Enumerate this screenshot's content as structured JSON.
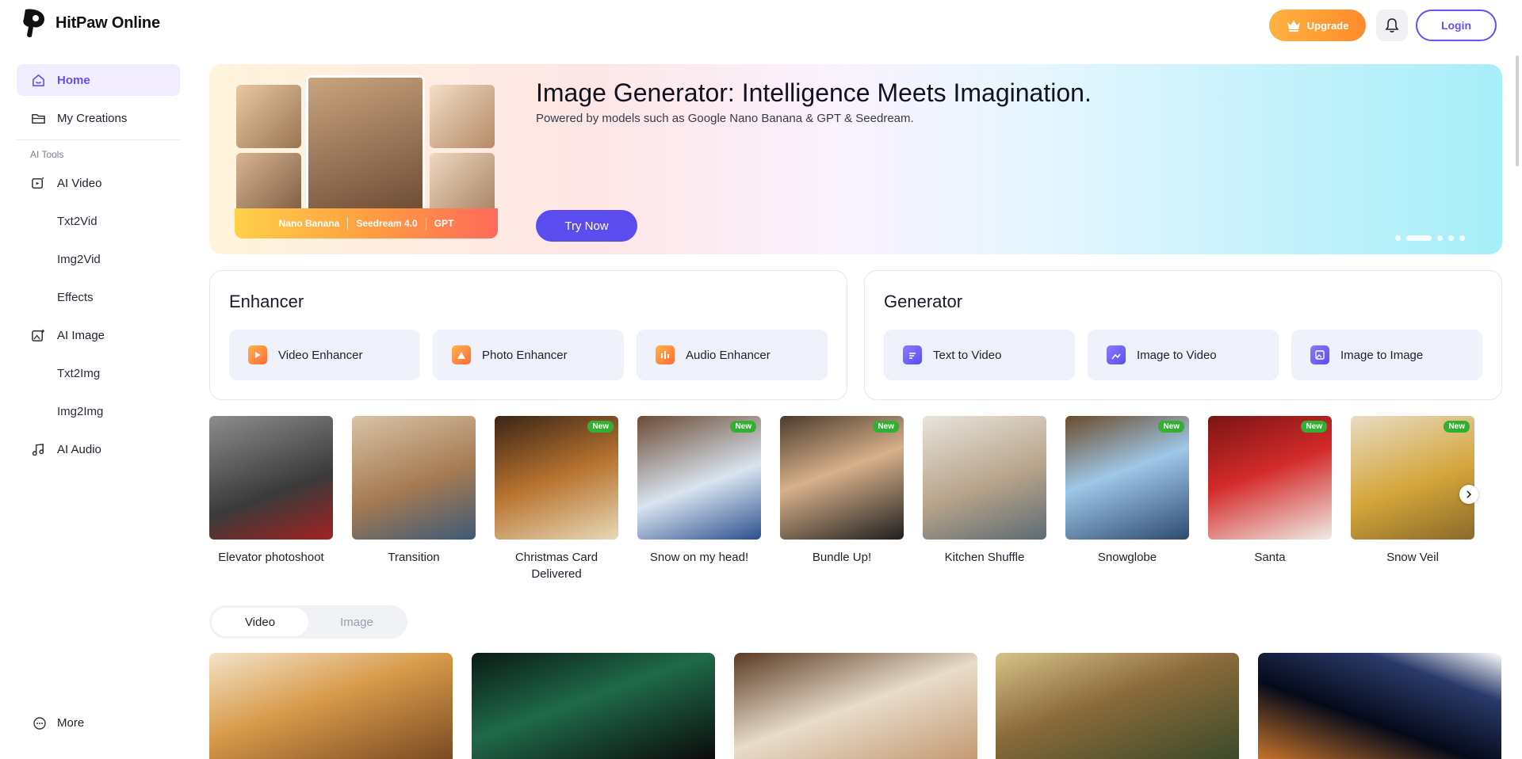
{
  "header": {
    "brand": "HitPaw Online",
    "upgrade_label": "Upgrade",
    "login_label": "Login"
  },
  "sidebar": {
    "home": "Home",
    "my_creations": "My Creations",
    "section_label": "AI Tools",
    "ai_video": "AI Video",
    "txt2vid": "Txt2Vid",
    "img2vid": "Img2Vid",
    "effects": "Effects",
    "ai_image": "AI Image",
    "txt2img": "Txt2Img",
    "img2img": "Img2Img",
    "ai_audio": "AI Audio",
    "more": "More"
  },
  "banner": {
    "title": "Image Generator: Intelligence Meets Imagination.",
    "subtitle": "Powered by models such as Google Nano Banana & GPT & Seedream.",
    "cta": "Try Now",
    "models": [
      "Nano Banana",
      "Seedream 4.0",
      "GPT"
    ]
  },
  "enhancer": {
    "title": "Enhancer",
    "tools": [
      "Video Enhancer",
      "Photo Enhancer",
      "Audio Enhancer"
    ]
  },
  "generator": {
    "title": "Generator",
    "tools": [
      "Text to Video",
      "Image to Video",
      "Image to Image"
    ]
  },
  "effects": [
    {
      "label": "Elevator photoshoot",
      "badge": ""
    },
    {
      "label": "Transition",
      "badge": ""
    },
    {
      "label": "Christmas Card Delivered",
      "badge": "New"
    },
    {
      "label": "Snow on my head!",
      "badge": "New"
    },
    {
      "label": "Bundle Up!",
      "badge": "New"
    },
    {
      "label": "Kitchen Shuffle",
      "badge": ""
    },
    {
      "label": "Snowglobe",
      "badge": "New"
    },
    {
      "label": "Santa",
      "badge": "New"
    },
    {
      "label": "Snow Veil",
      "badge": "New"
    }
  ],
  "toggle": {
    "video": "Video",
    "image": "Image"
  },
  "colors": {
    "accent": "#6152f5",
    "upgrade": "#ff8a2b",
    "new_badge": "#32b032"
  }
}
